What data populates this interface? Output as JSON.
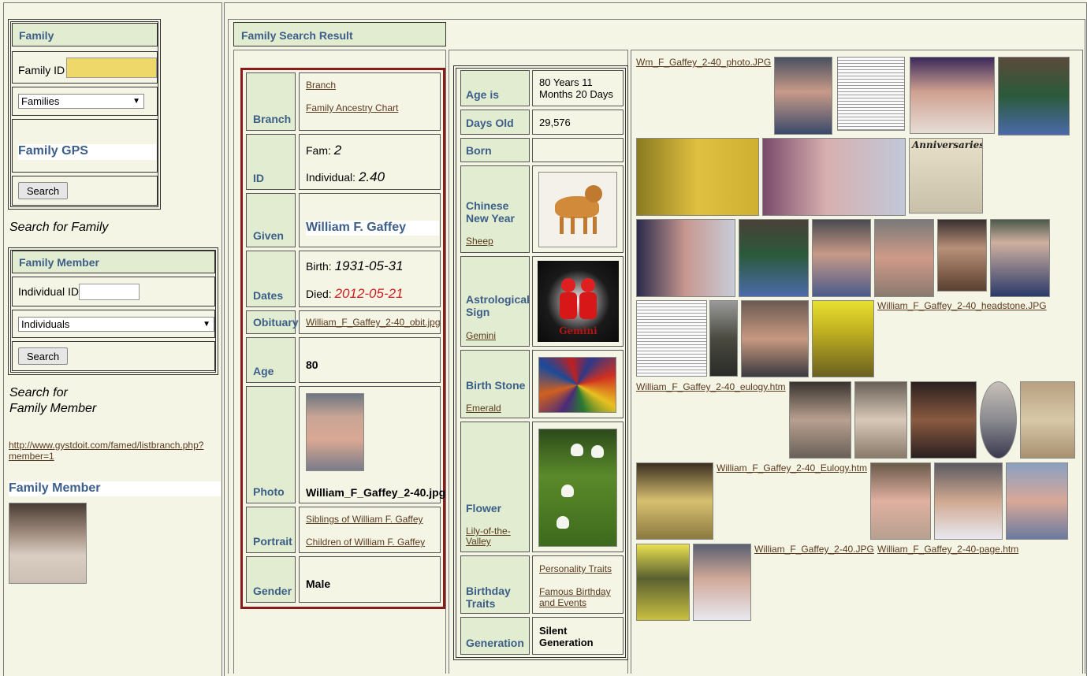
{
  "sidebar": {
    "family_box": {
      "header": "Family",
      "family_id_label": "Family ID",
      "family_id_value": "",
      "families_select": "Families",
      "gps_label": "Family GPS",
      "search_button": "Search"
    },
    "search_for_family": "Search for Family",
    "member_box": {
      "header": "Family Member",
      "individual_id_label": "Individual ID",
      "individual_id_value": "",
      "individuals_select": "Individuals",
      "search_button": "Search"
    },
    "search_for_member_line1": "Search for",
    "search_for_member_line2": "Family Member",
    "link_line1": "http://www.gystdoit.com/famed/listbranch.php?",
    "link_line2": "member=1",
    "family_member_label": "Family Member"
  },
  "main": {
    "title": "Family Search Result",
    "record": {
      "branch_label": "Branch",
      "branch_link": "Branch",
      "ancestry_link": "Family Ancestry Chart",
      "id_label": "ID",
      "fam_prefix": "Fam:",
      "fam_value": "2",
      "individual_prefix": "Individual:",
      "individual_value": "2.40",
      "given_label": "Given",
      "given_value": "William F. Gaffey",
      "dates_label": "Dates",
      "birth_prefix": "Birth:",
      "birth_value": "1931-05-31",
      "died_prefix": "Died:",
      "died_value": "2012-05-21",
      "obituary_label": "Obituary",
      "obituary_link": "William_F_Gaffey_2-40_obit.jpg",
      "age_label": "Age",
      "age_value": "80",
      "photo_label": "Photo",
      "photo_file": "William_F_Gaffey_2-40.jpg",
      "portrait_label": "Portrait",
      "siblings_link": "Siblings of William F. Gaffey",
      "children_link": "Children of William F. Gaffey",
      "gender_label": "Gender",
      "gender_value": "Male"
    },
    "facts": {
      "age_is_label": "Age is",
      "age_is_value": "80 Years 11 Months 20 Days",
      "days_old_label": "Days Old",
      "days_old_value": "29,576",
      "born_label": "Born",
      "born_value": "",
      "chinese_label": "Chinese New Year",
      "chinese_link": "Sheep",
      "astro_label": "Astrological Sign",
      "astro_link": "Gemini",
      "astro_image_text": "Gemini",
      "stone_label": "Birth Stone",
      "stone_link": "Emerald",
      "flower_label": "Flower",
      "flower_link": "Lily-of-the-Valley",
      "traits_label": "Birthday Traits",
      "personality_link": "Personality Traits",
      "famous_link": "Famous Birthday and Events",
      "generation_label": "Generation",
      "generation_value": "Silent Generation"
    },
    "gallery": {
      "link_photo": "Wm_F_Gaffey_2-40_photo.JPG",
      "link_headstone": "William_F_Gaffey_2-40_headstone.JPG",
      "link_eulogy": "William_F_Gaffey_2-40_eulogy.htm",
      "link_eulogy2": "William_F_Gaffey_2-40_Eulogy.htm",
      "link_jpg": "William_F_Gaffey_2-40.JPG",
      "link_page": "William_F_Gaffey_2-40-page.htm",
      "anniversary_text": "Anniversaries"
    }
  },
  "colors": {
    "header_bg": "#e1ecd0",
    "label_text": "#3c5e88",
    "accent_border": "#8b1a1a",
    "died_date": "#cc1f1f",
    "input_highlight": "#eed86a"
  }
}
